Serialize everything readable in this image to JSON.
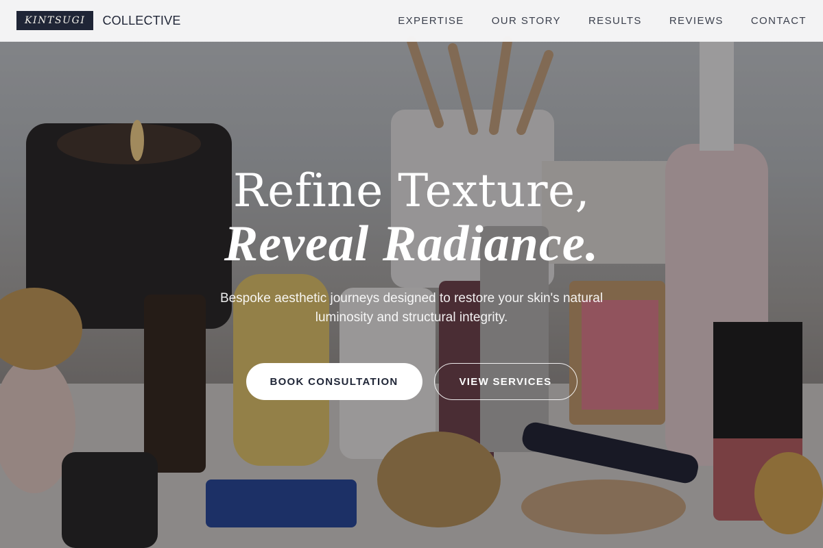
{
  "brand": {
    "mark": "KINTSUGI",
    "word": "COLLECTIVE"
  },
  "nav": {
    "items": [
      {
        "label": "EXPERTISE"
      },
      {
        "label": "OUR STORY"
      },
      {
        "label": "RESULTS"
      },
      {
        "label": "REVIEWS"
      },
      {
        "label": "CONTACT"
      }
    ]
  },
  "hero": {
    "headline_line1": "Refine Texture,",
    "headline_line2": "Reveal Radiance.",
    "subtext": "Bespoke aesthetic journeys designed to restore your skin's natural luminosity and structural integrity.",
    "primary_cta": "BOOK CONSULTATION",
    "secondary_cta": "VIEW SERVICES",
    "background_image": "cosmetics-vanity-photo"
  },
  "colors": {
    "brand_navy": "#1f2536",
    "nav_background": "#f8f8f9",
    "text_on_hero": "#ffffff"
  }
}
